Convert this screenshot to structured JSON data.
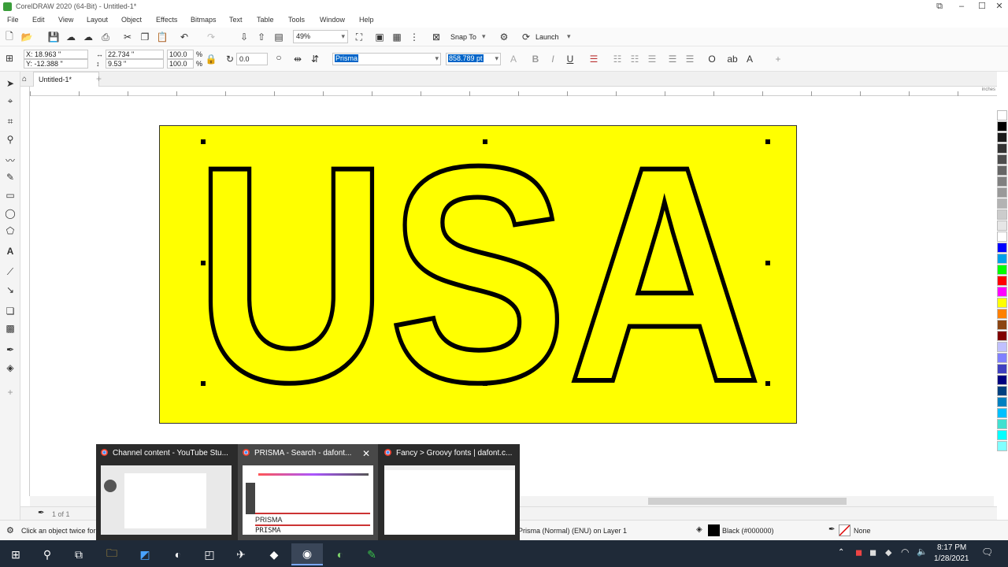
{
  "window": {
    "title": "CorelDRAW 2020 (64-Bit) - Untitled-1*"
  },
  "menu": [
    "File",
    "Edit",
    "View",
    "Layout",
    "Object",
    "Effects",
    "Bitmaps",
    "Text",
    "Table",
    "Tools",
    "Window",
    "Help"
  ],
  "toolbar": {
    "zoom": "49%",
    "snap_to": "Snap To",
    "launch": "Launch"
  },
  "propbar": {
    "x": "X: 18.963 \"",
    "y": "Y: -12.388 \"",
    "w": "22.734 \"",
    "h": "9.53 \"",
    "scale_w": "100.0",
    "scale_h": "100.0",
    "percent": "%",
    "rotation": "0.0",
    "font": "Prisma",
    "font_size": "858.789 pt"
  },
  "document": {
    "tab": "Untitled-1*",
    "artwork_text": "USA"
  },
  "doc_nav": {
    "page_info": "1 of 1"
  },
  "status": {
    "hint": "Click an object twice for",
    "object_info": "Prisma (Normal) (ENU) on Layer 1",
    "fill": "Black (#000000)",
    "outline": "None"
  },
  "thumbnails": [
    {
      "title": "Channel content - YouTube Stu..."
    },
    {
      "title": "PRISMA - Search - dafont...",
      "preview_text_1": "PRISMA",
      "preview_text_2": "PRISMA"
    },
    {
      "title": "Fancy > Groovy fonts | dafont.c..."
    }
  ],
  "clock": {
    "time": "8:17 PM",
    "date": "1/28/2021"
  },
  "ruler_unit": "inches",
  "colors": {
    "page_fill": "#ffff00",
    "text_fill": "#000000",
    "taskbar": "#1f2a38"
  },
  "palette": [
    "#ffffff",
    "#000000",
    "#1a1a1a",
    "#333333",
    "#4d4d4d",
    "#666666",
    "#808080",
    "#999999",
    "#b3b3b3",
    "#cccccc",
    "#e6e6e6",
    "#ffffff",
    "#0000ff",
    "#00a0e9",
    "#00ff00",
    "#ff0000",
    "#ff00ff",
    "#ffff00",
    "#ff8000",
    "#8b4513",
    "#800000",
    "#c0c0ff",
    "#8080ff",
    "#4040c0",
    "#000080",
    "#004080",
    "#0080c0",
    "#00c0ff",
    "#40e0d0",
    "#00ffff",
    "#80ffff"
  ]
}
